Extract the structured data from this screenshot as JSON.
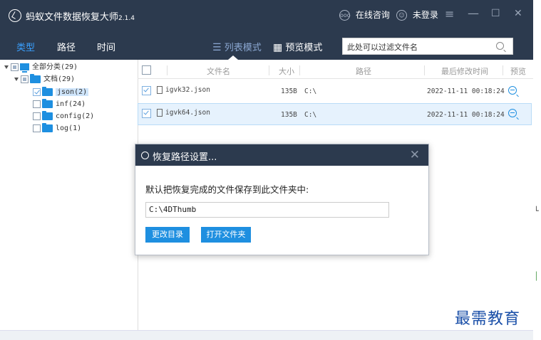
{
  "app": {
    "title": "蚂蚁文件数据恢复大师",
    "version": "2.1.4"
  },
  "header": {
    "consult": "在线咨询",
    "login": "未登录",
    "menu_icon": "≡",
    "min_icon": "—",
    "max_icon": "☐",
    "close_icon": "✕"
  },
  "tabs": [
    {
      "label": "类型"
    },
    {
      "label": "路径"
    },
    {
      "label": "时间"
    }
  ],
  "view_modes": {
    "list": "列表模式",
    "preview": "预览模式"
  },
  "filter": {
    "placeholder": "此处可以过滤文件名"
  },
  "tree": {
    "root": "全部分类(29)",
    "docs": "文档(29)",
    "children": [
      {
        "label": "json(2)"
      },
      {
        "label": "inf(24)"
      },
      {
        "label": "config(2)"
      },
      {
        "label": "log(1)"
      }
    ]
  },
  "table": {
    "headers": {
      "name": "文件名",
      "size": "大小",
      "path": "路径",
      "modified": "最后修改时间",
      "preview": "预览"
    },
    "rows": [
      {
        "name": "igvk32.json",
        "size": "135B",
        "path": "C:\\",
        "modified": "2022-11-11 00:18:24"
      },
      {
        "name": "igvk64.json",
        "size": "135B",
        "path": "C:\\",
        "modified": "2022-11-11 00:18:24"
      }
    ]
  },
  "dialog": {
    "title": "恢复路径设置...",
    "message": "默认把恢复完成的文件保存到此文件夹中:",
    "path": "C:\\4DThumb",
    "change_dir": "更改目录",
    "open_folder": "打开文件夹",
    "close_icon": "✕"
  },
  "watermark": "最需教育",
  "colors": {
    "titlebar": "#2c3a4e",
    "accent": "#1e8fe0",
    "active_tab": "#3aa0ff"
  }
}
